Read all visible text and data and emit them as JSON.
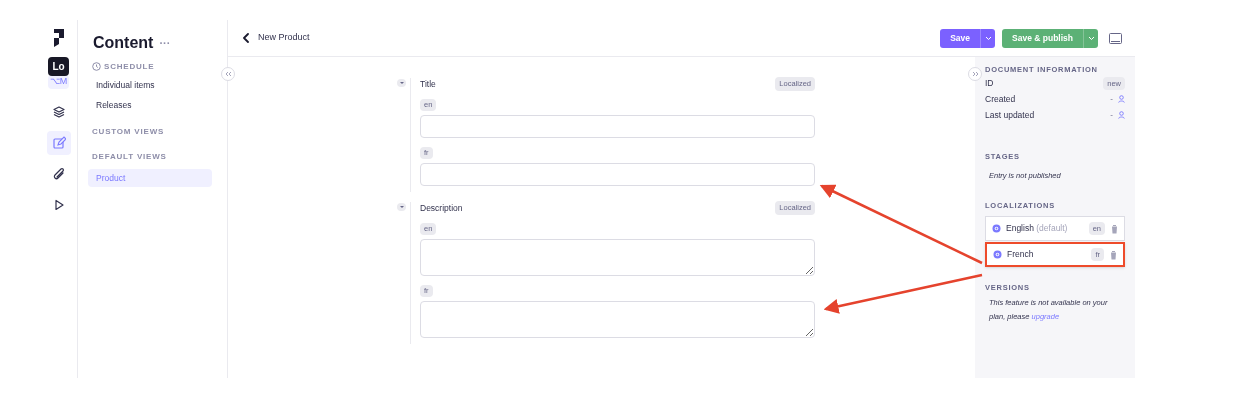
{
  "rail": {
    "tooltip": "Lo",
    "shortcut": "⌥M",
    "items": [
      {
        "kind": "layers",
        "selected": false
      },
      {
        "kind": "edit",
        "selected": true
      },
      {
        "kind": "attach",
        "selected": false
      },
      {
        "kind": "play",
        "selected": false
      }
    ]
  },
  "sidebar": {
    "title": "Content",
    "more": "···",
    "sections": [
      {
        "heading": "SCHEDULE",
        "kind": "clock",
        "items": [
          {
            "label": "Individual items",
            "selected": false
          },
          {
            "label": "Releases",
            "selected": false
          }
        ]
      },
      {
        "heading": "CUSTOM VIEWS"
      },
      {
        "heading": "DEFAULT VIEWS",
        "items": [
          {
            "label": "Product",
            "selected": true
          }
        ]
      }
    ]
  },
  "header": {
    "title": "New Product",
    "buttons": [
      {
        "label": "Save",
        "kind": "primary"
      },
      {
        "label": "Save & publish",
        "kind": "success"
      }
    ]
  },
  "fields": [
    {
      "label": "Title",
      "badge": "Localized",
      "kind": "input",
      "locales": [
        {
          "code": "en"
        },
        {
          "code": "fr"
        }
      ]
    },
    {
      "label": "Description",
      "badge": "Localized",
      "kind": "textarea",
      "locales": [
        {
          "code": "en"
        },
        {
          "code": "fr"
        }
      ]
    }
  ],
  "panel": {
    "info_heading": "DOCUMENT INFORMATION",
    "info": [
      {
        "label": "ID",
        "value": "new",
        "kind": "badge"
      },
      {
        "label": "Created",
        "value": "-",
        "kind": "user"
      },
      {
        "label": "Last updated",
        "value": "-",
        "kind": "user"
      }
    ],
    "stages_heading": "STAGES",
    "stage": "Entry is not published",
    "localizations_heading": "LOCALIZATIONS",
    "localizations": [
      {
        "name": "English",
        "note": "(default)",
        "code": "en",
        "highlighted": false
      },
      {
        "name": "French",
        "code": "fr",
        "highlighted": true
      }
    ],
    "versions_heading": "VERSIONS",
    "versions_text": "This feature is not available on your plan, please",
    "versions_link": "upgrade"
  }
}
